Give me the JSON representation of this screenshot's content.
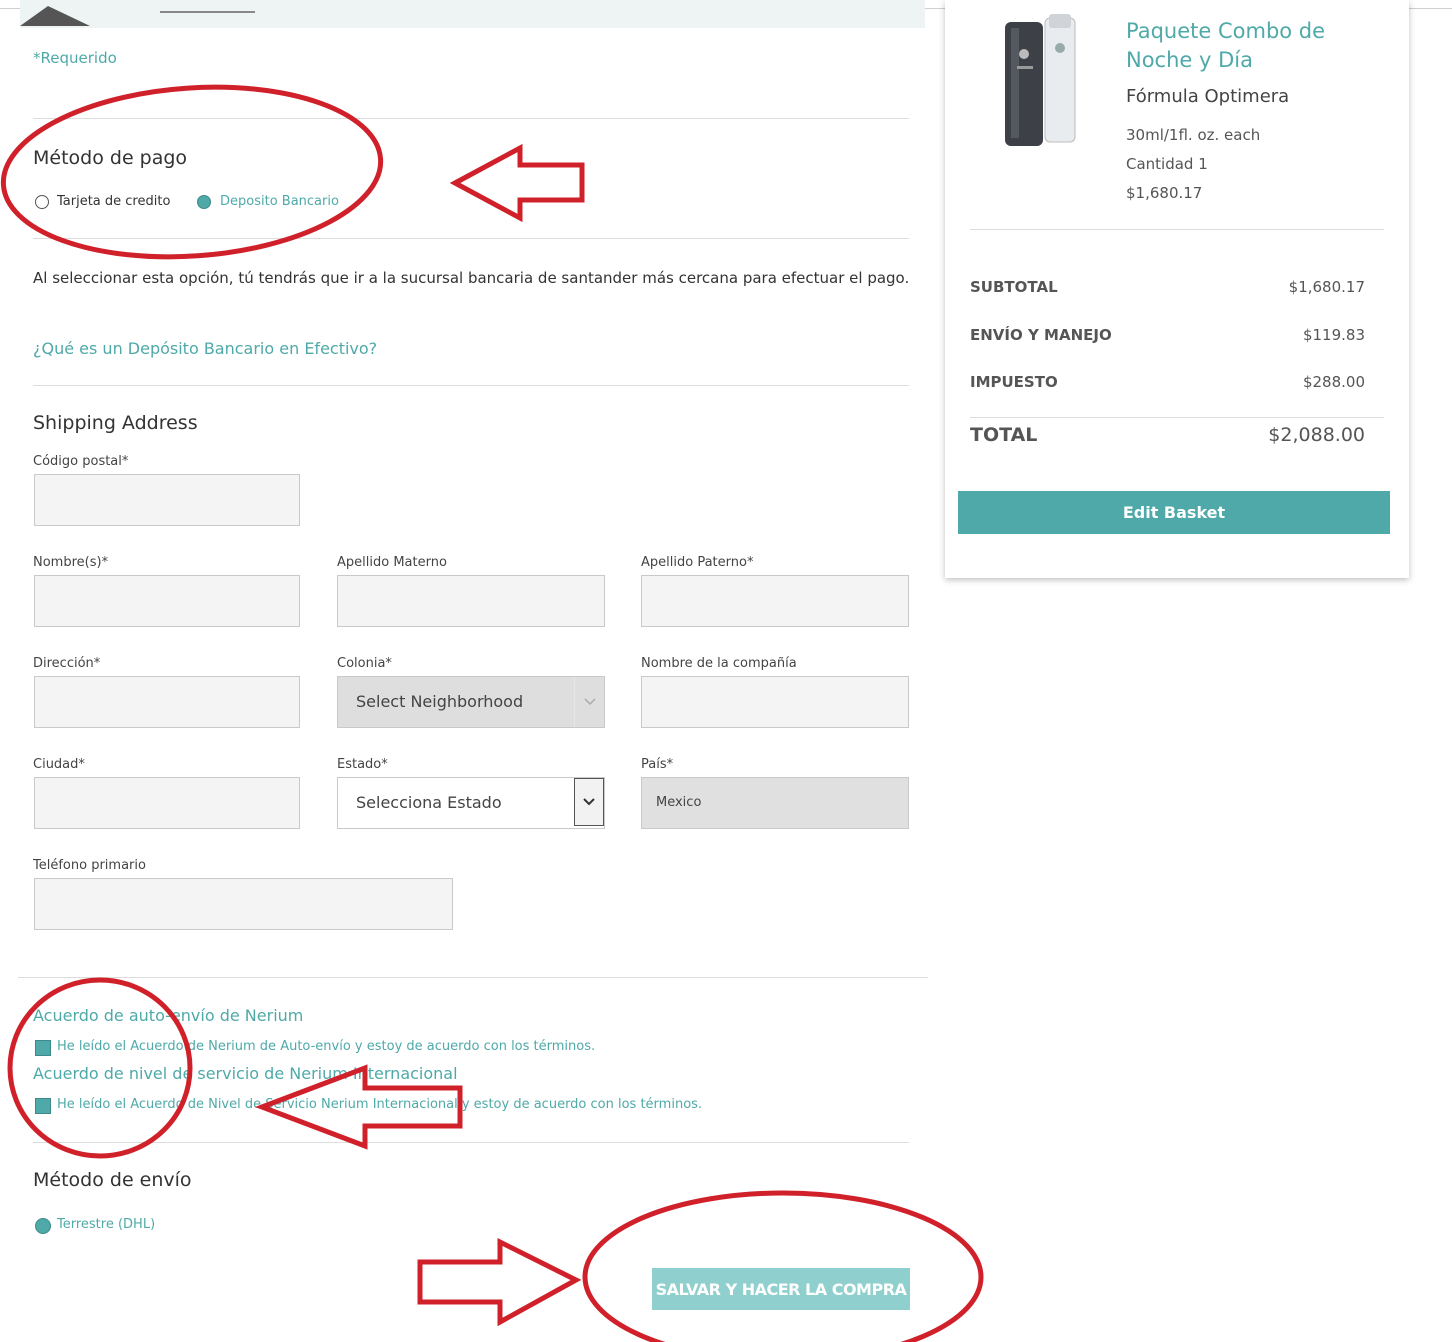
{
  "form": {
    "required_note": "*Requerido",
    "payment": {
      "title": "Método de pago",
      "options": [
        "Tarjeta de credito",
        "Deposito Bancario"
      ],
      "selected": "Deposito Bancario"
    },
    "deposit_info": "Al seleccionar esta opción, tú tendrás que ir a la sucursal bancaria de santander más cercana para efectuar el pago.",
    "deposit_link": "¿Qué es un Depósito Bancario en Efectivo?",
    "shipping": {
      "title": "Shipping Address",
      "labels": {
        "postal": "Código postal*",
        "first_name": "Nombre(s)*",
        "maternal": "Apellido Materno",
        "paternal": "Apellido Paterno*",
        "address": "Dirección*",
        "colonia": "Colonia*",
        "company": "Nombre de la compañía",
        "city": "Ciudad*",
        "state": "Estado*",
        "country": "País*",
        "phone": "Teléfono primario"
      },
      "colonia_value": "Select Neighborhood",
      "state_value": "Selecciona Estado",
      "country_value": "Mexico"
    },
    "agreements": {
      "auto_title": "Acuerdo de auto-envío de Nerium",
      "auto_check": "He leído el Acuerdo de Nerium de Auto-envío y estoy de acuerdo con los términos.",
      "service_title": "Acuerdo de nivel de servicio de Nerium Internacional",
      "service_check": "He leído el Acuerdo de Nivel de Servicio Nerium Internacional y estoy de acuerdo con los términos."
    },
    "shipping_method": {
      "title": "Método de envío",
      "option": "Terrestre (DHL)"
    },
    "submit_label": "SALVAR Y HACER LA COMPRA"
  },
  "cart": {
    "product_name": "Paquete Combo de Noche y Día",
    "product_subtitle": "Fórmula Optimera",
    "size": "30ml/1fl. oz. each",
    "quantity": "Cantidad 1",
    "price": "$1,680.17",
    "subtotal_label": "SUBTOTAL",
    "subtotal_value": "$1,680.17",
    "shipping_label": "ENVÍO Y MANEJO",
    "shipping_value": "$119.83",
    "tax_label": "IMPUESTO",
    "tax_value": "$288.00",
    "total_label": "TOTAL",
    "total_value": "$2,088.00",
    "edit_button": "Edit Basket"
  },
  "colors": {
    "accent": "#4fa9a9",
    "annotation": "#d0202a"
  }
}
